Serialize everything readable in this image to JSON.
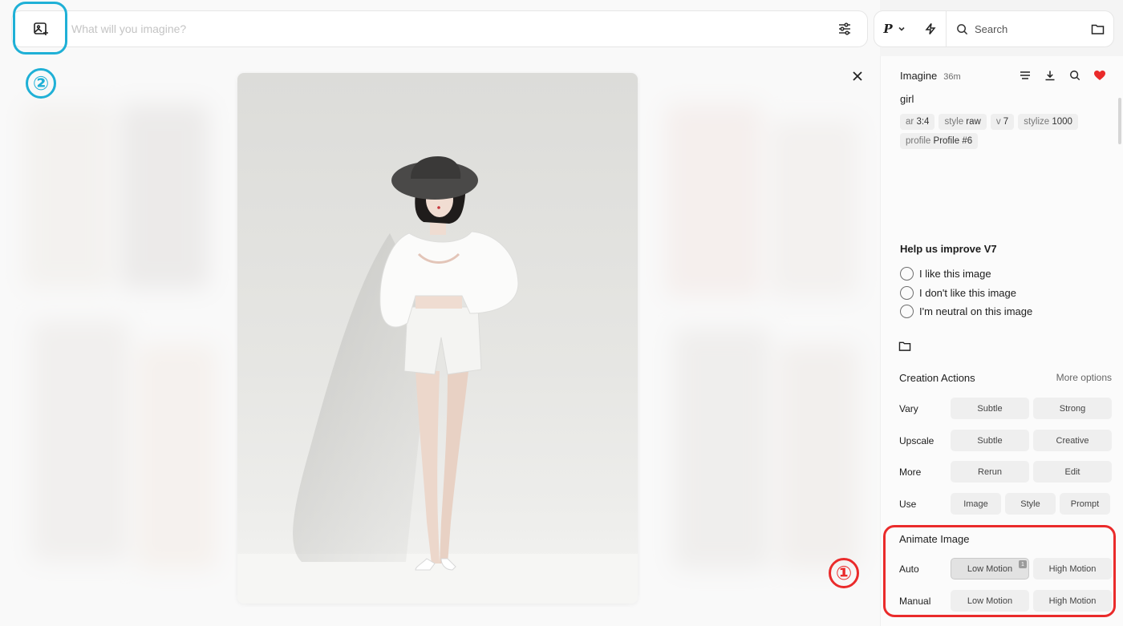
{
  "prompt_bar": {
    "placeholder": "What will you imagine?",
    "upload_icon": "image-add-icon",
    "settings_icon": "sliders-icon"
  },
  "right_bar": {
    "profile_letter": "P",
    "bolt_icon": "bolt-icon",
    "search_label": "Search",
    "folder_icon": "folder-icon"
  },
  "annotations": {
    "badge_1": "①",
    "badge_2": "②",
    "highlight_colors": {
      "blue": "#1fb0d6",
      "red": "#ea2b2b"
    }
  },
  "panel": {
    "mode": "Imagine",
    "time": "36m",
    "prompt": "girl",
    "params": [
      {
        "key": "ar",
        "value": "3:4"
      },
      {
        "key": "style",
        "value": "raw"
      },
      {
        "key": "v",
        "value": "7"
      },
      {
        "key": "stylize",
        "value": "1000"
      },
      {
        "key": "profile",
        "value": "Profile #6"
      }
    ],
    "header_icons": [
      "menu-icon",
      "download-icon",
      "search-icon",
      "heart-icon"
    ],
    "improve": {
      "title": "Help us improve V7",
      "options": [
        "I like this image",
        "I don't like this image",
        "I'm neutral on this image"
      ]
    },
    "creation_actions": {
      "title": "Creation Actions",
      "more_options": "More options",
      "rows": [
        {
          "label": "Vary",
          "buttons": [
            "Subtle",
            "Strong"
          ]
        },
        {
          "label": "Upscale",
          "buttons": [
            "Subtle",
            "Creative"
          ]
        },
        {
          "label": "More",
          "buttons": [
            "Rerun",
            "Edit"
          ]
        },
        {
          "label": "Use",
          "buttons": [
            "Image",
            "Style",
            "Prompt"
          ]
        }
      ]
    },
    "animate": {
      "title": "Animate Image",
      "rows": [
        {
          "label": "Auto",
          "buttons": [
            "Low Motion",
            "High Motion"
          ],
          "badge": "1"
        },
        {
          "label": "Manual",
          "buttons": [
            "Low Motion",
            "High Motion"
          ]
        }
      ]
    }
  }
}
